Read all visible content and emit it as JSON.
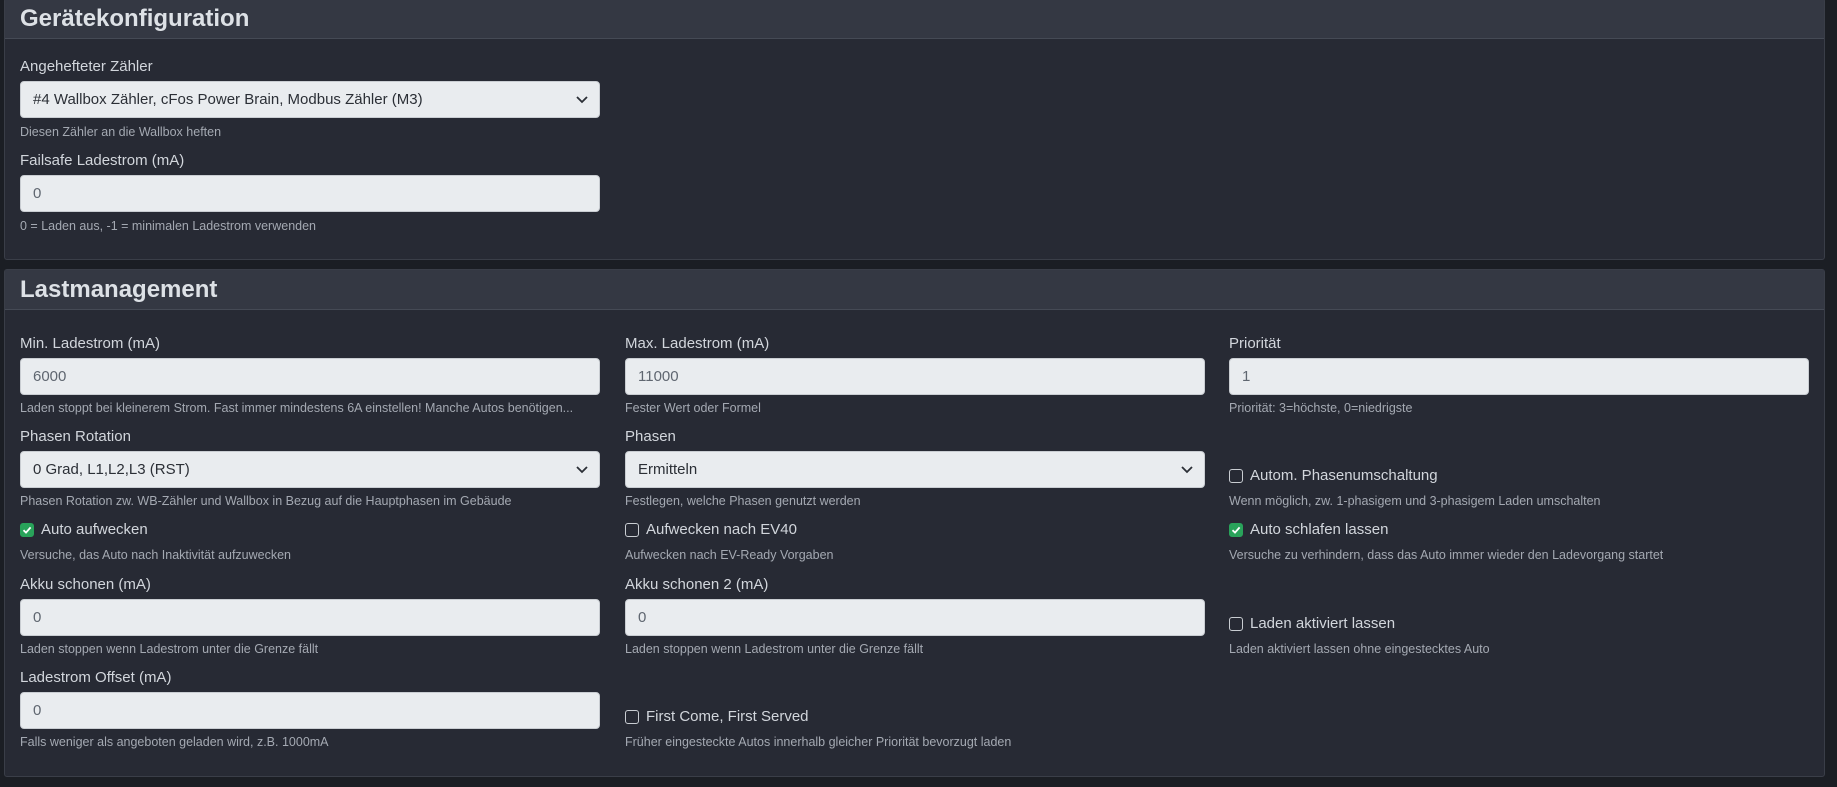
{
  "geraete": {
    "title": "Gerätekonfiguration",
    "meter_label": "Angehefteter Zähler",
    "meter_value": "#4 Wallbox Zähler, cFos Power Brain, Modbus Zähler (M3)",
    "meter_help": "Diesen Zähler an die Wallbox heften",
    "failsafe_label": "Failsafe Ladestrom (mA)",
    "failsafe_value": "0",
    "failsafe_help": "0 = Laden aus, -1 = minimalen Ladestrom verwenden"
  },
  "last": {
    "title": "Lastmanagement",
    "min_label": "Min. Ladestrom (mA)",
    "min_value": "6000",
    "min_help": "Laden stoppt bei kleinerem Strom. Fast immer mindestens 6A einstellen! Manche Autos benötigen...",
    "max_label": "Max. Ladestrom (mA)",
    "max_value": "11000",
    "max_help": "Fester Wert oder Formel",
    "prio_label": "Priorität",
    "prio_value": "1",
    "prio_help": "Priorität: 3=höchste, 0=niedrigste",
    "rotation_label": "Phasen Rotation",
    "rotation_value": "0 Grad, L1,L2,L3 (RST)",
    "rotation_help": "Phasen Rotation zw. WB-Zähler und Wallbox in Bezug auf die Hauptphasen im Gebäude",
    "phasen_label": "Phasen",
    "phasen_value": "Ermitteln",
    "phasen_help": "Festlegen, welche Phasen genutzt werden",
    "autophase_label": "Autom. Phasenumschaltung",
    "autophase_checked": false,
    "autophase_help": "Wenn möglich, zw. 1-phasigem und 3-phasigem Laden umschalten",
    "wake_label": "Auto aufwecken",
    "wake_checked": true,
    "wake_help": "Versuche, das Auto nach Inaktivität aufzuwecken",
    "wake_ev40_label": "Aufwecken nach EV40",
    "wake_ev40_checked": false,
    "wake_ev40_help": "Aufwecken nach EV-Ready Vorgaben",
    "sleep_label": "Auto schlafen lassen",
    "sleep_checked": true,
    "sleep_help": "Versuche zu verhindern, dass das Auto immer wieder den Ladevorgang startet",
    "akku_label": "Akku schonen (mA)",
    "akku_value": "0",
    "akku_help": "Laden stoppen wenn Ladestrom unter die Grenze fällt",
    "akku2_label": "Akku schonen 2 (mA)",
    "akku2_value": "0",
    "akku2_help": "Laden stoppen wenn Ladestrom unter die Grenze fällt",
    "keep_label": "Laden aktiviert lassen",
    "keep_checked": false,
    "keep_help": "Laden aktiviert lassen ohne eingestecktes Auto",
    "offset_label": "Ladestrom Offset (mA)",
    "offset_value": "0",
    "offset_help": "Falls weniger als angeboten geladen wird, z.B. 1000mA",
    "fcfs_label": "First Come, First Served",
    "fcfs_checked": false,
    "fcfs_help": "Früher eingesteckte Autos innerhalb gleicher Priorität bevorzugt laden"
  }
}
